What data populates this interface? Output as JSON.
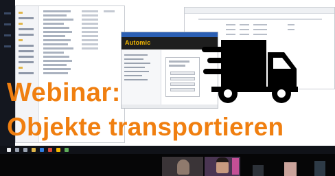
{
  "app": {
    "brand": "Automic"
  },
  "overlay": {
    "line1": "Webinar:",
    "line2": "Objekte transportieren"
  },
  "icons": {
    "hero": "delivery-truck-icon",
    "taskbar": [
      "windows-start-icon",
      "search-icon",
      "task-view-icon",
      "explorer-icon",
      "browser-icon",
      "app-icon"
    ]
  },
  "colors": {
    "title": "#f07f10",
    "brand_text": "#f5b800",
    "brand_bar": "#1e1e1e",
    "taskbar": "#101218"
  }
}
